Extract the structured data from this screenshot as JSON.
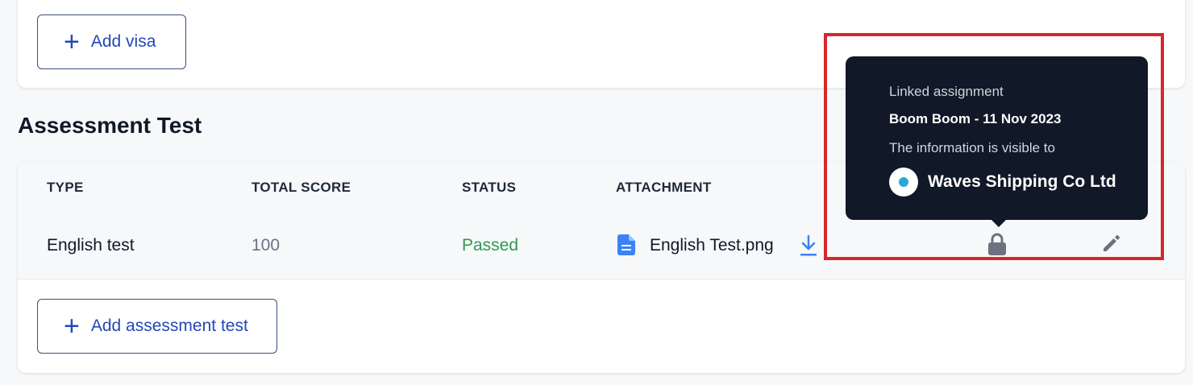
{
  "visa": {
    "add_button_label": "Add visa"
  },
  "assessment": {
    "section_title": "Assessment Test",
    "columns": [
      "TYPE",
      "TOTAL SCORE",
      "STATUS",
      "ATTACHMENT"
    ],
    "row": {
      "type": "English test",
      "total_score": "100",
      "status": "Passed",
      "attachment": "English Test.png"
    },
    "add_button_label": "Add assessment test"
  },
  "tooltip": {
    "linked_label": "Linked assignment",
    "assignment": "Boom Boom - 11 Nov 2023",
    "visible_label": "The information is visible to",
    "company": "Waves Shipping Co Ltd"
  },
  "icons": {
    "plus": "plus-icon",
    "file": "file-icon",
    "download": "download-icon",
    "lock": "lock-icon",
    "edit": "pencil-icon"
  },
  "colors": {
    "accent": "#2447b8",
    "status_passed": "#2e9a4f",
    "tooltip_bg": "#111827",
    "highlight": "#d7262c",
    "file_icon": "#3b82f6",
    "download_icon": "#3b82f6"
  }
}
